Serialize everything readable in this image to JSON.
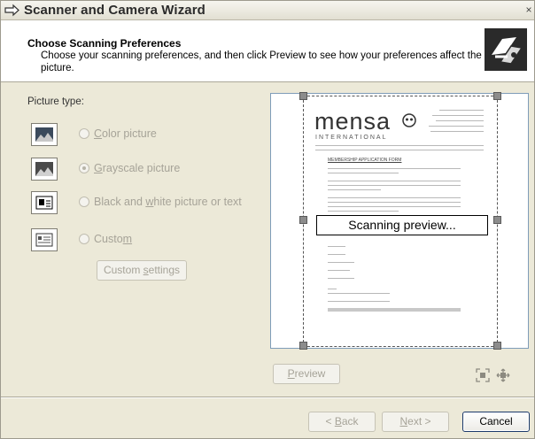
{
  "window": {
    "title": "Scanner and Camera Wizard",
    "close_symbol": "×"
  },
  "header": {
    "title": "Choose Scanning Preferences",
    "subtitle": "Choose your scanning preferences, and then click Preview to see how your preferences affect the picture."
  },
  "picture_type": {
    "label": "Picture type:",
    "options": [
      {
        "pre": "",
        "ul": "C",
        "post": "olor picture",
        "selected": false,
        "icon": "color-picture-icon"
      },
      {
        "pre": "",
        "ul": "G",
        "post": "rayscale picture",
        "selected": true,
        "icon": "grayscale-picture-icon"
      },
      {
        "pre": "Black and ",
        "ul": "w",
        "post": "hite picture or text",
        "selected": false,
        "icon": "black-white-picture-icon"
      },
      {
        "pre": "Custo",
        "ul": "m",
        "post": "",
        "selected": false,
        "icon": "custom-picture-icon"
      }
    ],
    "custom_settings": {
      "pre": "Custom ",
      "ul": "s",
      "post": "ettings"
    }
  },
  "preview": {
    "status": "Scanning preview...",
    "logo_word": "mensa",
    "logo_sub": "INTERNATIONAL",
    "form_title": "MEMBERSHIP APPLICATION FORM",
    "button": {
      "pre": "",
      "ul": "P",
      "post": "review"
    }
  },
  "footer": {
    "back": {
      "pre": "< ",
      "ul": "B",
      "post": "ack"
    },
    "next": {
      "pre": "",
      "ul": "N",
      "post": "ext >"
    },
    "cancel": "Cancel"
  }
}
